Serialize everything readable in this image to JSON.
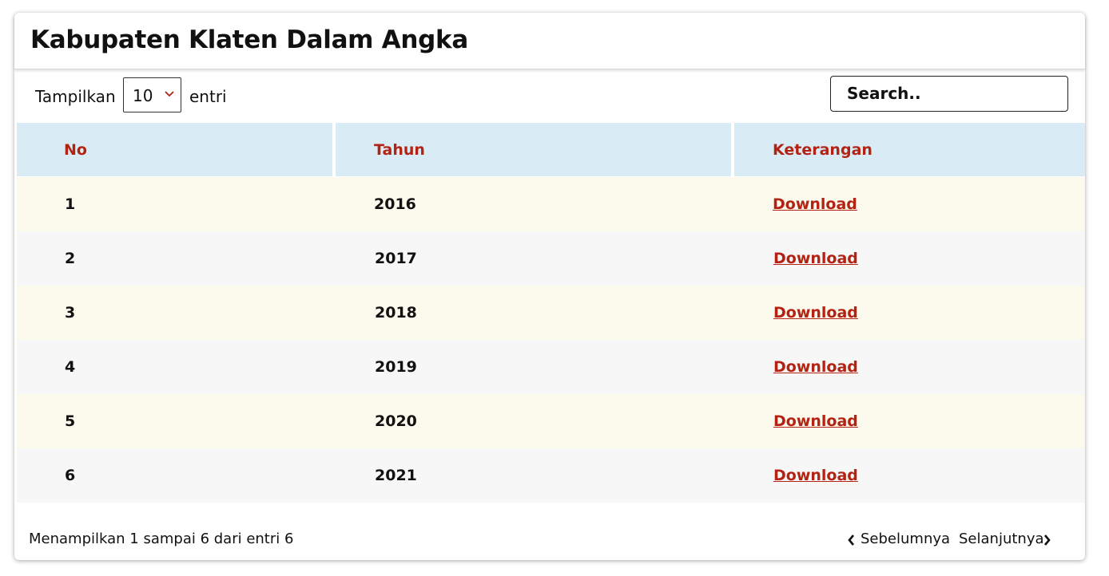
{
  "header": {
    "title": "Kabupaten Klaten Dalam Angka"
  },
  "controls": {
    "show_label": "Tampilkan",
    "page_length": "10",
    "entries_label": "entri",
    "search_placeholder": "Search.."
  },
  "table": {
    "columns": [
      "No",
      "Tahun",
      "Keterangan"
    ],
    "rows": [
      {
        "no": "1",
        "year": "2016",
        "link": "Download"
      },
      {
        "no": "2",
        "year": "2017",
        "link": "Download"
      },
      {
        "no": "3",
        "year": "2018",
        "link": "Download"
      },
      {
        "no": "4",
        "year": "2019",
        "link": "Download"
      },
      {
        "no": "5",
        "year": "2020",
        "link": "Download"
      },
      {
        "no": "6",
        "year": "2021",
        "link": "Download"
      }
    ]
  },
  "footer": {
    "info": "Menampilkan 1 sampai 6 dari entri 6",
    "prev_label": "Sebelumnya",
    "next_label": "Selanjutnya"
  },
  "colors": {
    "accent": "#b32314",
    "header_bg": "#d9ecf5",
    "row_odd_bg": "#fcfaec",
    "row_even_bg": "#f7f7f7"
  },
  "icons": {
    "select": "chevron-down-icon",
    "prev": "chevron-left-icon",
    "next": "chevron-right-icon"
  }
}
